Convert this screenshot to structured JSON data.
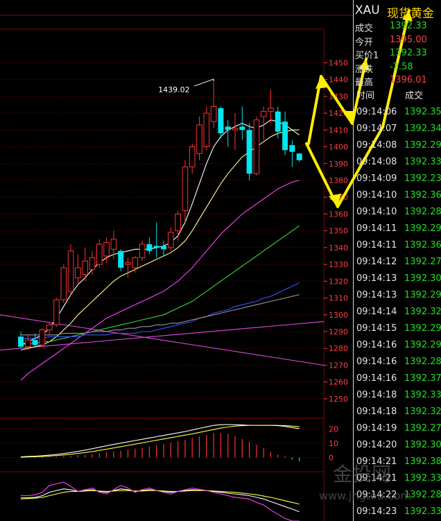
{
  "quote_panel": {
    "symbol": "XAU",
    "name": "现货黄金",
    "rows": [
      {
        "label": "成交",
        "value": "1392.33",
        "color": "#22dd22"
      },
      {
        "label": "今开",
        "value": "1395.00",
        "color": "#ff4040"
      },
      {
        "label": "买价1",
        "value": "1392.33",
        "color": "#22dd22"
      },
      {
        "label": "涨跌",
        "value": "-2.58",
        "color": "#22dd22"
      },
      {
        "label": "最高",
        "value": "1396.01",
        "color": "#ff4040"
      }
    ],
    "tick_header": {
      "time": "时间",
      "price": "成交"
    },
    "ticks": [
      {
        "time": "09:14:06",
        "price": "1392.35"
      },
      {
        "time": "09:14:07",
        "price": "1392.34"
      },
      {
        "time": "09:14:08",
        "price": "1392.29"
      },
      {
        "time": "09:14:08",
        "price": "1392.33"
      },
      {
        "time": "09:14:09",
        "price": "1392.23"
      },
      {
        "time": "09:14:10",
        "price": "1392.36"
      },
      {
        "time": "09:14:10",
        "price": "1392.28"
      },
      {
        "time": "09:14:11",
        "price": "1392.29"
      },
      {
        "time": "09:14:11",
        "price": "1392.36"
      },
      {
        "time": "09:14:12",
        "price": "1392.27"
      },
      {
        "time": "09:14:13",
        "price": "1392.30"
      },
      {
        "time": "09:14:13",
        "price": "1392.29"
      },
      {
        "time": "09:14:14",
        "price": "1392.32"
      },
      {
        "time": "09:14:15",
        "price": "1392.29"
      },
      {
        "time": "09:14:16",
        "price": "1392.29"
      },
      {
        "time": "09:14:16",
        "price": "1392.28"
      },
      {
        "time": "09:14:16",
        "price": "1392.37"
      },
      {
        "time": "09:14:18",
        "price": "1392.33"
      },
      {
        "time": "09:14:18",
        "price": "1392.32"
      },
      {
        "time": "09:14:19",
        "price": "1392.27"
      },
      {
        "time": "09:14:20",
        "price": "1392.30"
      },
      {
        "time": "09:14:21",
        "price": "1392.38"
      },
      {
        "time": "09:14:21",
        "price": "1392.33"
      },
      {
        "time": "09:14:22",
        "price": "1392.28"
      },
      {
        "time": "09:14:23",
        "price": "1392.33"
      }
    ]
  },
  "watermark": {
    "name": "金投网",
    "url": "www.jngtou.com"
  },
  "colors": {
    "up": "#ff3333",
    "down": "#00e5ee",
    "grid": "#8b0000",
    "axis": "#ff4040",
    "arrow": "#ffee00"
  },
  "chart_data": [
    {
      "type": "candlestick",
      "annotation": "1439.02",
      "ylim": [
        1245,
        1470
      ],
      "yticks": [
        1250,
        1260,
        1270,
        1280,
        1290,
        1300,
        1310,
        1320,
        1330,
        1340,
        1350,
        1360,
        1370,
        1380,
        1390,
        1400,
        1410,
        1420,
        1430,
        1440,
        1450
      ],
      "candles": [
        {
          "o": 1287,
          "h": 1290,
          "l": 1280,
          "c": 1281
        },
        {
          "o": 1281,
          "h": 1288,
          "l": 1279,
          "c": 1285
        },
        {
          "o": 1285,
          "h": 1289,
          "l": 1281,
          "c": 1282
        },
        {
          "o": 1282,
          "h": 1292,
          "l": 1281,
          "c": 1291
        },
        {
          "o": 1291,
          "h": 1296,
          "l": 1288,
          "c": 1294
        },
        {
          "o": 1294,
          "h": 1310,
          "l": 1293,
          "c": 1309
        },
        {
          "o": 1309,
          "h": 1330,
          "l": 1307,
          "c": 1328
        },
        {
          "o": 1314,
          "h": 1342,
          "l": 1312,
          "c": 1338
        },
        {
          "o": 1322,
          "h": 1336,
          "l": 1318,
          "c": 1328
        },
        {
          "o": 1324,
          "h": 1340,
          "l": 1320,
          "c": 1332
        },
        {
          "o": 1327,
          "h": 1338,
          "l": 1324,
          "c": 1334
        },
        {
          "o": 1330,
          "h": 1345,
          "l": 1328,
          "c": 1342
        },
        {
          "o": 1335,
          "h": 1346,
          "l": 1331,
          "c": 1343
        },
        {
          "o": 1339,
          "h": 1350,
          "l": 1333,
          "c": 1345
        },
        {
          "o": 1338,
          "h": 1339,
          "l": 1326,
          "c": 1328
        },
        {
          "o": 1330,
          "h": 1334,
          "l": 1322,
          "c": 1331
        },
        {
          "o": 1328,
          "h": 1335,
          "l": 1325,
          "c": 1334
        },
        {
          "o": 1334,
          "h": 1344,
          "l": 1332,
          "c": 1342
        },
        {
          "o": 1342,
          "h": 1346,
          "l": 1336,
          "c": 1338
        },
        {
          "o": 1341,
          "h": 1355,
          "l": 1334,
          "c": 1340
        },
        {
          "o": 1341,
          "h": 1344,
          "l": 1335,
          "c": 1339
        },
        {
          "o": 1340,
          "h": 1352,
          "l": 1338,
          "c": 1349
        },
        {
          "o": 1350,
          "h": 1362,
          "l": 1344,
          "c": 1360
        },
        {
          "o": 1362,
          "h": 1392,
          "l": 1355,
          "c": 1388
        },
        {
          "o": 1388,
          "h": 1402,
          "l": 1384,
          "c": 1400
        },
        {
          "o": 1396,
          "h": 1418,
          "l": 1392,
          "c": 1413
        },
        {
          "o": 1400,
          "h": 1424,
          "l": 1398,
          "c": 1420
        },
        {
          "o": 1415,
          "h": 1439.02,
          "l": 1411,
          "c": 1424
        },
        {
          "o": 1423,
          "h": 1424,
          "l": 1405,
          "c": 1408
        },
        {
          "o": 1412,
          "h": 1416,
          "l": 1400,
          "c": 1410
        },
        {
          "o": 1410,
          "h": 1420,
          "l": 1398,
          "c": 1411
        },
        {
          "o": 1412,
          "h": 1424,
          "l": 1404,
          "c": 1410
        },
        {
          "o": 1410,
          "h": 1414,
          "l": 1380,
          "c": 1384
        },
        {
          "o": 1384,
          "h": 1418,
          "l": 1383,
          "c": 1416
        },
        {
          "o": 1418,
          "h": 1424,
          "l": 1404,
          "c": 1421
        },
        {
          "o": 1421,
          "h": 1434,
          "l": 1414,
          "c": 1423
        },
        {
          "o": 1421,
          "h": 1424,
          "l": 1405,
          "c": 1409
        },
        {
          "o": 1415,
          "h": 1421,
          "l": 1395,
          "c": 1398
        },
        {
          "o": 1401,
          "h": 1404,
          "l": 1388,
          "c": 1397
        },
        {
          "o": 1396,
          "h": 1396,
          "l": 1391,
          "c": 1392
        }
      ],
      "moving_averages": [
        {
          "color": "#ffffff",
          "values": [
            1282,
            1284,
            1286,
            1288,
            1292,
            1298,
            1305,
            1312,
            1318,
            1322,
            1327,
            1331,
            1334,
            1336,
            1337,
            1338,
            1339,
            1339,
            1339,
            1340,
            1341,
            1343,
            1347,
            1355,
            1366,
            1378,
            1390,
            1400,
            1406,
            1410,
            1412,
            1414,
            1412,
            1411,
            1413,
            1416,
            1415,
            1413,
            1410,
            1407
          ]
        },
        {
          "color": "#ffff99",
          "values": [
            1279,
            1280,
            1281,
            1282,
            1284,
            1287,
            1291,
            1295,
            1300,
            1304,
            1308,
            1312,
            1316,
            1320,
            1323,
            1325,
            1327,
            1329,
            1331,
            1333,
            1335,
            1337,
            1340,
            1344,
            1350,
            1357,
            1364,
            1371,
            1378,
            1384,
            1389,
            1394,
            1397,
            1400,
            1403,
            1406,
            1408,
            1409,
            1410,
            1410
          ]
        },
        {
          "color": "#ff44ff",
          "values": [
            1261,
            1265,
            1268,
            1271,
            1274,
            1277,
            1280,
            1283,
            1286,
            1289,
            1292,
            1295,
            1298,
            1300,
            1302,
            1304,
            1306,
            1308,
            1310,
            1312,
            1314,
            1317,
            1320,
            1324,
            1328,
            1333,
            1338,
            1343,
            1348,
            1352,
            1356,
            1360,
            1363,
            1366,
            1369,
            1372,
            1375,
            1377,
            1379,
            1380
          ]
        },
        {
          "color": "#33dd33",
          "values": [
            1282,
            1283,
            1283,
            1284,
            1284,
            1285,
            1286,
            1287,
            1288,
            1289,
            1290,
            1291,
            1292,
            1293,
            1294,
            1295,
            1296,
            1297,
            1298,
            1299,
            1300,
            1302,
            1304,
            1306,
            1308,
            1311,
            1314,
            1317,
            1320,
            1323,
            1326,
            1329,
            1332,
            1335,
            1338,
            1341,
            1344,
            1347,
            1350,
            1353
          ]
        },
        {
          "color": "#3355ff",
          "values": [
            1286,
            1286,
            1286,
            1286,
            1287,
            1287,
            1287,
            1287,
            1287,
            1288,
            1288,
            1288,
            1288,
            1289,
            1289,
            1289,
            1289,
            1290,
            1290,
            1291,
            1292,
            1293,
            1294,
            1295,
            1296,
            1298,
            1299,
            1301,
            1302,
            1303,
            1305,
            1306,
            1307,
            1308,
            1310,
            1311,
            1313,
            1315,
            1317,
            1319
          ]
        },
        {
          "color": "#999999",
          "values": [
            1288,
            1288,
            1288,
            1288,
            1288,
            1288,
            1289,
            1289,
            1289,
            1289,
            1290,
            1290,
            1290,
            1291,
            1291,
            1292,
            1292,
            1293,
            1293,
            1294,
            1294,
            1295,
            1295,
            1296,
            1297,
            1298,
            1299,
            1300,
            1301,
            1302,
            1303,
            1304,
            1305,
            1306,
            1307,
            1308,
            1309,
            1310,
            1311,
            1312
          ]
        }
      ],
      "trend_lines": [
        {
          "color": "#cc44cc",
          "from": [
            0,
            1300
          ],
          "to": [
            40,
            1270
          ]
        },
        {
          "color": "#cc44cc",
          "from": [
            0,
            1279
          ],
          "to": [
            40,
            1296
          ]
        }
      ]
    },
    {
      "type": "macd",
      "ylim": [
        -8,
        26
      ],
      "yticks": [
        0,
        10,
        20
      ],
      "histogram": [
        0.3,
        0.4,
        0.4,
        0.5,
        0.6,
        0.7,
        0.9,
        1.2,
        1.6,
        2,
        2.5,
        3,
        3.6,
        4.2,
        4.8,
        5.5,
        6.2,
        7,
        7.8,
        8.6,
        9.5,
        10.4,
        11.4,
        12.5,
        13.6,
        14.8,
        16,
        17.2,
        17,
        16.5,
        15,
        13,
        11,
        9,
        6.5,
        4,
        2,
        1,
        -1.5,
        -2.5
      ],
      "lines": [
        {
          "color": "#ffffff",
          "values": [
            0.5,
            0.8,
            1,
            1.3,
            1.7,
            2.2,
            2.8,
            3.5,
            4.3,
            5.2,
            6.2,
            7.2,
            8.2,
            9.2,
            10.1,
            11,
            11.9,
            12.8,
            13.7,
            14.6,
            15.5,
            16.4,
            17.3,
            18.2,
            19.3,
            20.4,
            21.5,
            22.5,
            23,
            23.1,
            23,
            22.8,
            22.6,
            22.5,
            22.5,
            22.5,
            22.3,
            21.8,
            21,
            20.2
          ]
        },
        {
          "color": "#ffff44",
          "values": [
            0.2,
            0.4,
            0.6,
            0.8,
            1.1,
            1.4,
            1.8,
            2.3,
            2.9,
            3.5,
            4.2,
            5,
            5.8,
            6.7,
            7.6,
            8.5,
            9.4,
            10.3,
            11.2,
            12.1,
            13,
            13.9,
            14.8,
            15.7,
            16.6,
            17.6,
            18.6,
            19.6,
            20.6,
            21.4,
            22,
            22.3,
            22.5,
            22.6,
            22.6,
            22.6,
            22.5,
            22.3,
            22,
            21.6
          ]
        }
      ]
    },
    {
      "type": "kdj",
      "ylim": [
        0,
        110
      ],
      "lines": [
        {
          "color": "#ffffff",
          "values": [
            55,
            55,
            56,
            60,
            68,
            72,
            76,
            74,
            70,
            72,
            74,
            70,
            68,
            72,
            76,
            74,
            70,
            72,
            74,
            72,
            70,
            68,
            70,
            72,
            74,
            73,
            72,
            70,
            68,
            66,
            64,
            62,
            60,
            56,
            52,
            46,
            40,
            34,
            28,
            22
          ]
        },
        {
          "color": "#ffff44",
          "values": [
            52,
            53,
            54,
            56,
            60,
            64,
            68,
            70,
            70,
            71,
            72,
            71,
            70,
            71,
            72,
            72,
            71,
            71,
            72,
            72,
            71,
            70,
            70,
            71,
            72,
            72,
            72,
            71,
            70,
            69,
            68,
            66,
            64,
            62,
            59,
            56,
            52,
            48,
            44,
            40
          ]
        },
        {
          "color": "#ff44ff",
          "values": [
            60,
            60,
            62,
            68,
            84,
            88,
            92,
            82,
            70,
            74,
            78,
            68,
            64,
            74,
            84,
            78,
            68,
            74,
            78,
            72,
            68,
            64,
            70,
            74,
            78,
            75,
            72,
            68,
            64,
            60,
            56,
            54,
            52,
            44,
            38,
            26,
            16,
            6,
            0,
            0
          ]
        }
      ]
    }
  ]
}
